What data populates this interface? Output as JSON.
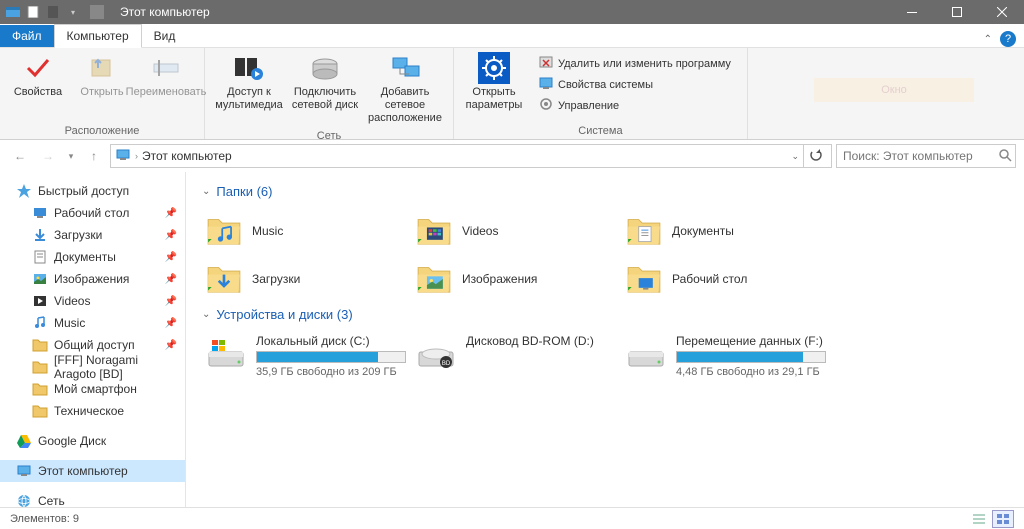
{
  "titlebar": {
    "title": "Этот компьютер"
  },
  "tabs": {
    "file": "Файл",
    "computer": "Компьютер",
    "view": "Вид"
  },
  "ribbon": {
    "loc": {
      "props": "Свойства",
      "open": "Открыть",
      "rename": "Переименовать",
      "group": "Расположение"
    },
    "net": {
      "media": "Доступ к мультимедиа",
      "map": "Подключить сетевой диск",
      "add": "Добавить сетевое расположение",
      "group": "Сеть"
    },
    "sys": {
      "open": "Открыть параметры",
      "uninstall": "Удалить или изменить программу",
      "sysprops": "Свойства системы",
      "manage": "Управление",
      "group": "Система"
    },
    "ghost": "Окно"
  },
  "nav": {
    "breadcrumb": "Этот компьютер",
    "search_placeholder": "Поиск: Этот компьютер"
  },
  "sidebar": {
    "quick": "Быстрый доступ",
    "items": [
      {
        "label": "Рабочий стол",
        "pin": true
      },
      {
        "label": "Загрузки",
        "pin": true
      },
      {
        "label": "Документы",
        "pin": true
      },
      {
        "label": "Изображения",
        "pin": true
      },
      {
        "label": "Videos",
        "pin": true
      },
      {
        "label": "Music",
        "pin": true
      },
      {
        "label": "Общий доступ",
        "pin": true
      },
      {
        "label": "[FFF] Noragami Aragoto [BD]",
        "pin": false
      },
      {
        "label": "Мой смартфон",
        "pin": false
      },
      {
        "label": "Техническое",
        "pin": false
      }
    ],
    "gdrive": "Google Диск",
    "thispc": "Этот компьютер",
    "network": "Сеть"
  },
  "content": {
    "folders": {
      "title": "Папки (6)",
      "items": [
        "Music",
        "Videos",
        "Документы",
        "Загрузки",
        "Изображения",
        "Рабочий стол"
      ]
    },
    "drives": {
      "title": "Устройства и диски (3)",
      "items": [
        {
          "name": "Локальный диск (C:)",
          "info": "35,9 ГБ свободно из 209 ГБ",
          "fill": 82,
          "type": "hdd"
        },
        {
          "name": "Дисковод BD-ROM (D:)",
          "info": "",
          "fill": 0,
          "type": "bd"
        },
        {
          "name": "Перемещение данных (F:)",
          "info": "4,48 ГБ свободно из 29,1 ГБ",
          "fill": 85,
          "type": "hdd"
        }
      ]
    }
  },
  "status": {
    "count": "Элементов: 9"
  }
}
